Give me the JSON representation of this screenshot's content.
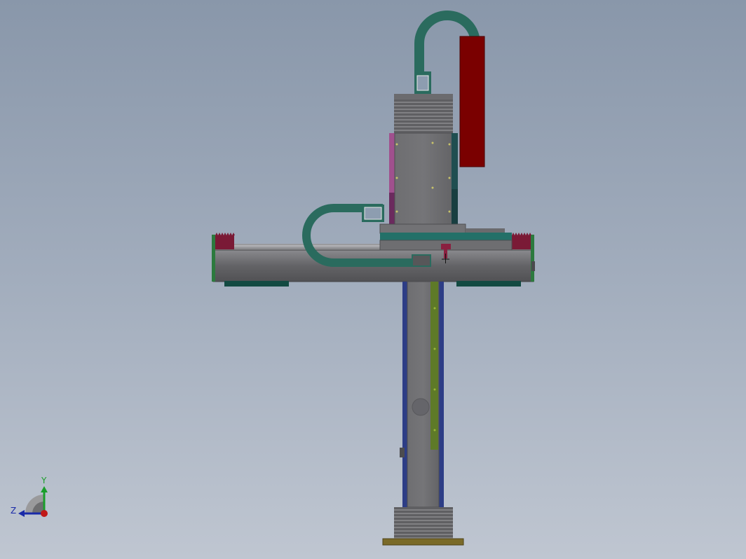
{
  "viewport": {
    "background_top": "#8997aa",
    "background_bottom": "#bfc6d1"
  },
  "model": {
    "colors": {
      "steel": "#6b6b6e",
      "steel_dark": "#545457",
      "steel_light": "#8a8a8e",
      "cable_chain": "#2a6b5e",
      "motor": "#7a0000",
      "rail_cover": "#7a1a36",
      "teal_plate": "#237068",
      "side_rail": "#2d3d86",
      "green_strip": "#5e7a28",
      "magenta_plate": "#a0508e",
      "base_plate": "#7a6a28"
    }
  },
  "triad": {
    "y_label": "Y",
    "z_label": "Z",
    "y_color": "#1a9e2a",
    "z_color": "#1a2aa8",
    "x_color": "#c01818"
  }
}
